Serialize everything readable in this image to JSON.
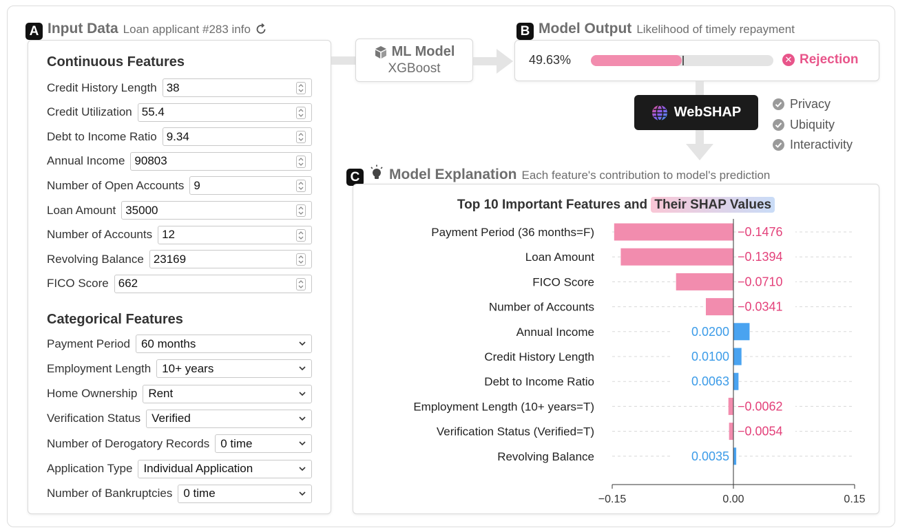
{
  "sections": {
    "a": {
      "badge": "A",
      "title": "Input Data",
      "subtitle": "Loan applicant #283 info"
    },
    "b": {
      "badge": "B",
      "title": "Model Output",
      "subtitle": "Likelihood of timely repayment"
    },
    "c": {
      "badge": "C",
      "title": "Model Explanation",
      "subtitle": "Each feature's contribution to model's prediction"
    }
  },
  "input": {
    "continuous_title": "Continuous Features",
    "continuous": [
      {
        "label": "Credit History Length",
        "value": "38"
      },
      {
        "label": "Credit Utilization",
        "value": "55.4"
      },
      {
        "label": "Debt to Income Ratio",
        "value": "9.34"
      },
      {
        "label": "Annual Income",
        "value": "90803"
      },
      {
        "label": "Number of Open Accounts",
        "value": "9"
      },
      {
        "label": "Loan Amount",
        "value": "35000"
      },
      {
        "label": "Number of Accounts",
        "value": "12"
      },
      {
        "label": "Revolving Balance",
        "value": "23169"
      },
      {
        "label": "FICO Score",
        "value": "662"
      }
    ],
    "categorical_title": "Categorical Features",
    "categorical": [
      {
        "label": "Payment Period",
        "value": "60 months"
      },
      {
        "label": "Employment Length",
        "value": "10+ years"
      },
      {
        "label": "Home Ownership",
        "value": "Rent"
      },
      {
        "label": "Verification Status",
        "value": "Verified"
      },
      {
        "label": "Number of Derogatory Records",
        "value": "0 time"
      },
      {
        "label": "Application Type",
        "value": "Individual Application"
      },
      {
        "label": "Number of Bankruptcies",
        "value": "0 time"
      }
    ]
  },
  "model": {
    "title": "ML Model",
    "name": "XGBoost"
  },
  "output": {
    "probability_text": "49.63%",
    "probability": 0.4963,
    "threshold": 0.5,
    "decision": "Rejection"
  },
  "webshap": {
    "label": "WebSHAP",
    "properties": [
      "Privacy",
      "Ubiquity",
      "Interactivity"
    ]
  },
  "colors": {
    "negative": "#f28cae",
    "negative_text": "#e3417a",
    "positive": "#4aa3f0",
    "positive_text": "#3b9be8"
  },
  "chart_data": {
    "type": "bar",
    "orientation": "horizontal",
    "title": "Top 10 Important Features and",
    "title_highlight": "Their SHAP Values",
    "categories": [
      "Payment Period (36 months=F)",
      "Loan Amount",
      "FICO Score",
      "Number of Accounts",
      "Annual Income",
      "Credit History Length",
      "Debt to Income Ratio",
      "Employment Length (10+ years=T)",
      "Verification Status (Verified=T)",
      "Revolving Balance"
    ],
    "values": [
      -0.1476,
      -0.1394,
      -0.071,
      -0.0341,
      0.02,
      0.01,
      0.0063,
      -0.0062,
      -0.0054,
      0.0035
    ],
    "value_labels": [
      "−0.1476",
      "−0.1394",
      "−0.0710",
      "−0.0341",
      "0.0200",
      "0.0100",
      "0.0063",
      "−0.0062",
      "−0.0054",
      "0.0035"
    ],
    "xlim": [
      -0.15,
      0.15
    ],
    "xticks": [
      -0.15,
      0,
      0.15
    ],
    "xtick_labels": [
      "−0.15",
      "0.00",
      "0.15"
    ],
    "grid": "dashed horizontal guide lines"
  }
}
